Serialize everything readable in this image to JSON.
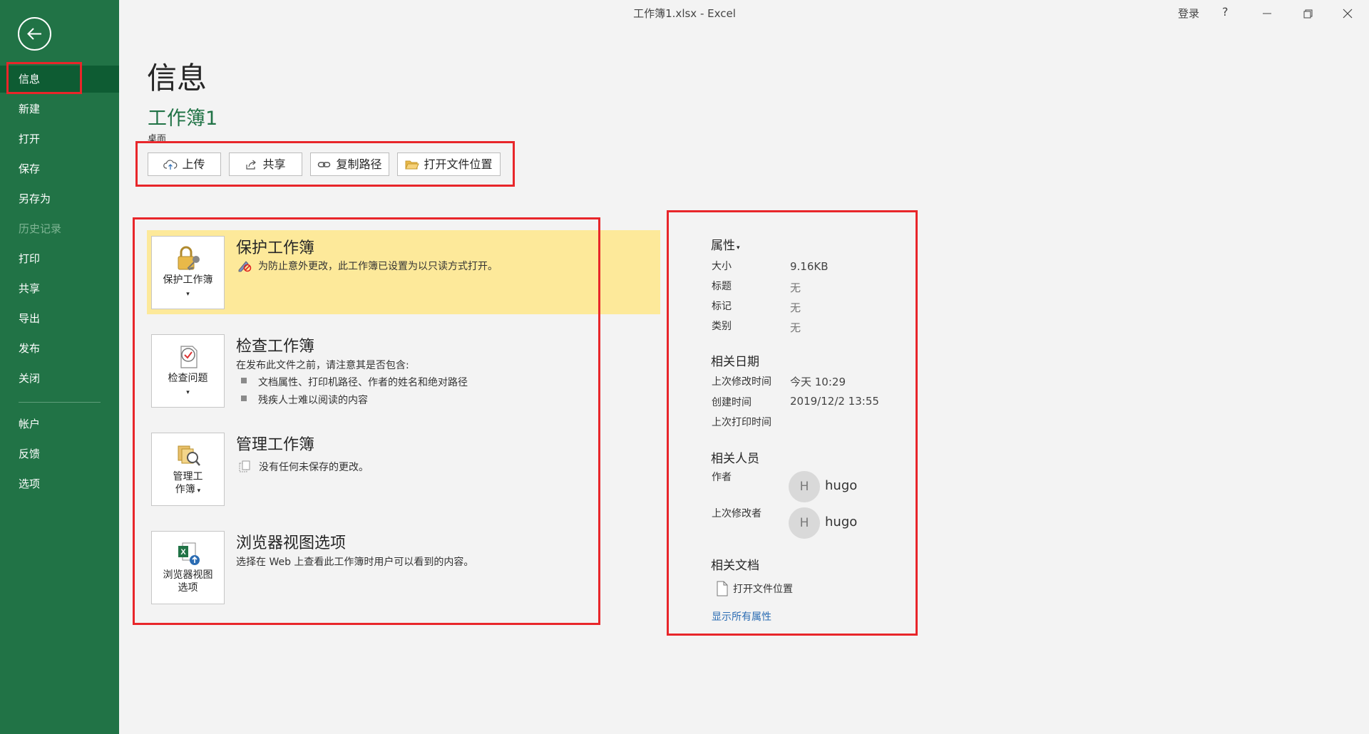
{
  "window": {
    "title": "工作簿1.xlsx  -  Excel",
    "login": "登录",
    "help": "?"
  },
  "sidebar": {
    "items": [
      {
        "label": "信息"
      },
      {
        "label": "新建"
      },
      {
        "label": "打开"
      },
      {
        "label": "保存"
      },
      {
        "label": "另存为"
      },
      {
        "label": "历史记录"
      },
      {
        "label": "打印"
      },
      {
        "label": "共享"
      },
      {
        "label": "导出"
      },
      {
        "label": "发布"
      },
      {
        "label": "关闭"
      },
      {
        "label": "帐户"
      },
      {
        "label": "反馈"
      },
      {
        "label": "选项"
      }
    ]
  },
  "page": {
    "title": "信息",
    "workbook_name": "工作簿1",
    "location": "桌面"
  },
  "actions": {
    "upload": "上传",
    "share": "共享",
    "copy_path": "复制路径",
    "open_location": "打开文件位置"
  },
  "sections": {
    "protect": {
      "tile": "保护工作簿",
      "title": "保护工作簿",
      "text": "为防止意外更改，此工作簿已设置为以只读方式打开。"
    },
    "inspect": {
      "tile": "检查问题",
      "title": "检查工作簿",
      "text": "在发布此文件之前，请注意其是否包含:",
      "bullets": [
        "文档属性、打印机路径、作者的姓名和绝对路径",
        "残疾人士难以阅读的内容"
      ]
    },
    "manage": {
      "tile_line1": "管理工",
      "tile_line2": "作簿",
      "title": "管理工作簿",
      "text": "没有任何未保存的更改。"
    },
    "browser": {
      "tile_line1": "浏览器视图",
      "tile_line2": "选项",
      "title": "浏览器视图选项",
      "text": "选择在 Web 上查看此工作簿时用户可以看到的内容。"
    }
  },
  "properties": {
    "heading": "属性",
    "size_label": "大小",
    "size_value": "9.16KB",
    "title_label": "标题",
    "title_value": "无",
    "tags_label": "标记",
    "tags_value": "无",
    "category_label": "类别",
    "category_value": "无",
    "dates_heading": "相关日期",
    "modified_label": "上次修改时间",
    "modified_value": "今天 10:29",
    "created_label": "创建时间",
    "created_value": "2019/12/2 13:55",
    "printed_label": "上次打印时间",
    "people_heading": "相关人员",
    "author_label": "作者",
    "author_initial": "H",
    "author_name": "hugo",
    "modifier_label": "上次修改者",
    "modifier_initial": "H",
    "modifier_name": "hugo",
    "docs_heading": "相关文档",
    "open_location": "打开文件位置",
    "show_all": "显示所有属性"
  },
  "colors": {
    "sidebar": "#217346",
    "sidebar_active": "#0e5c33",
    "highlight": "#fde99a",
    "annotation_red": "#e8262a",
    "link": "#2b6cb3"
  }
}
